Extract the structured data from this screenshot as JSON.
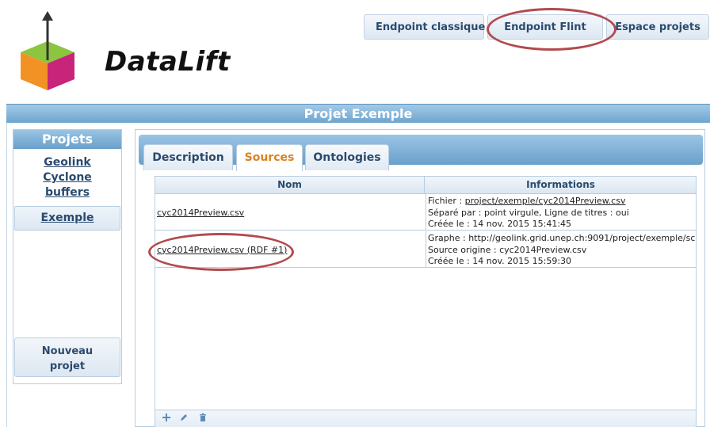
{
  "brand": {
    "name": "DataLift"
  },
  "topnav": {
    "items": [
      {
        "label": "Endpoint classique"
      },
      {
        "label": "Endpoint Flint"
      },
      {
        "label": "Espace projets"
      }
    ]
  },
  "project": {
    "title": "Projet Exemple"
  },
  "sidebar": {
    "title": "Projets",
    "items": [
      {
        "label_lines": [
          "Geolink",
          "Cyclone",
          "buffers"
        ]
      },
      {
        "label": "Exemple"
      }
    ],
    "new_button_lines": [
      "Nouveau",
      "projet"
    ]
  },
  "tabs": [
    {
      "label": "Description"
    },
    {
      "label": "Sources",
      "active": true
    },
    {
      "label": "Ontologies"
    }
  ],
  "grid": {
    "columns": [
      "Nom",
      "Informations"
    ],
    "rows": [
      {
        "name": "cyc2014Preview.csv",
        "info": {
          "line1_prefix": "Fichier : ",
          "line1_link": "project/exemple/cyc2014Preview.csv",
          "line2": "Séparé par : point virgule, Ligne de titres : oui",
          "line3": "Créée le : 14 nov. 2015 15:41:45"
        }
      },
      {
        "name": "cyc2014Preview.csv (RDF #1)",
        "info": {
          "line1": "Graphe : http://geolink.grid.unep.ch:9091/project/exemple/sc",
          "line2": "Source origine : cyc2014Preview.csv",
          "line3": "Créée le : 14 nov. 2015 15:59:30"
        }
      }
    ],
    "footer_icons": [
      "add-icon",
      "edit-icon",
      "delete-icon"
    ]
  },
  "colors": {
    "accent_blue": "#6ea5d0",
    "active_tab_text": "#d98222",
    "highlight_circle": "#b24a4f"
  }
}
